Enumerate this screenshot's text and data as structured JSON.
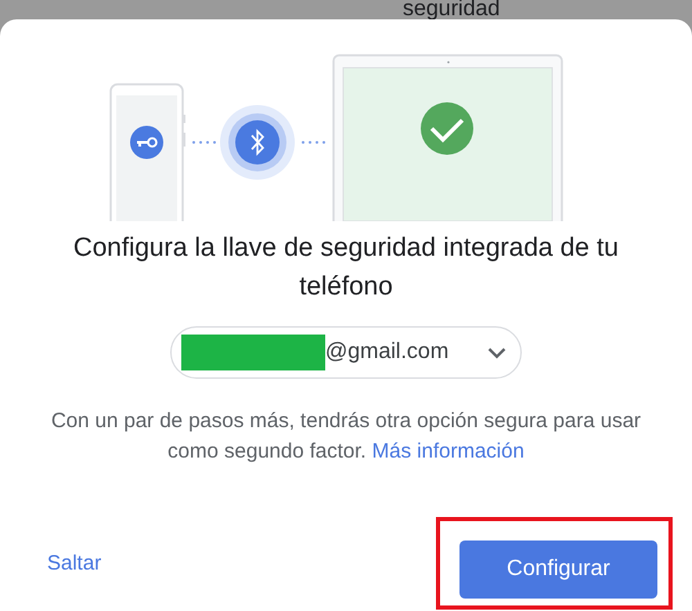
{
  "background_heading": "seguridad",
  "dialog": {
    "title": "Configura la llave de seguridad integrada de tu teléfono",
    "account": {
      "email": "@gmail.com",
      "redacted": true
    },
    "description": "Con un par de pasos más, tendrás otra opción segura para usar como segundo factor.",
    "link": "Más información",
    "buttons": [
      {
        "label": "Saltar",
        "kind": "text",
        "highlighted": false
      },
      {
        "label": "Configurar",
        "kind": "primary",
        "highlighted": true
      }
    ]
  }
}
